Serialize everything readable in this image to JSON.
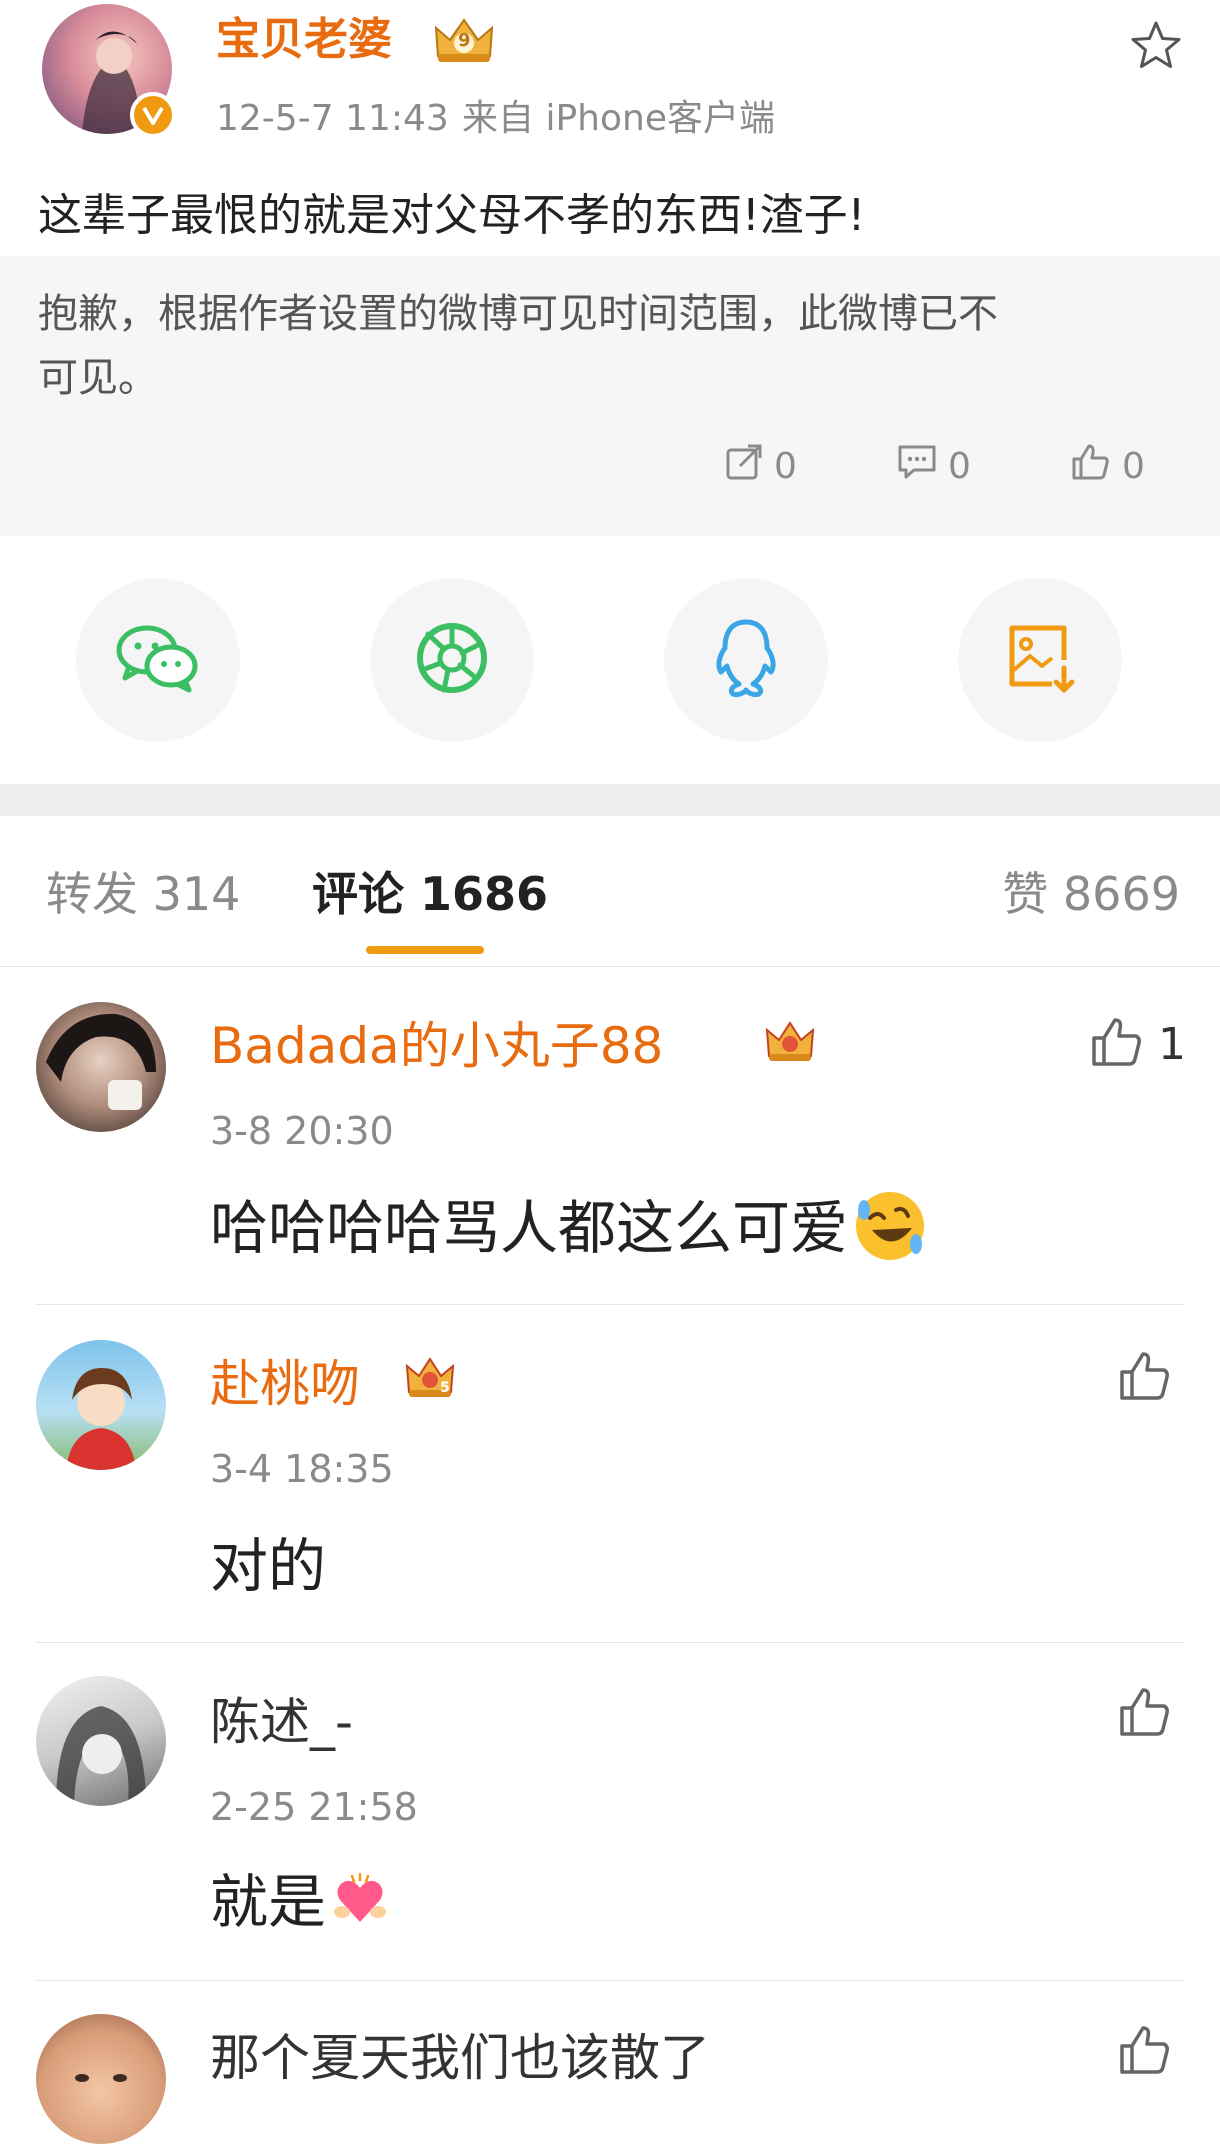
{
  "post": {
    "username": "宝贝老婆",
    "vip_level": "9",
    "date": "12-5-7 11:43",
    "source": "来自 iPhone客户端",
    "text": "这辈子最恨的就是对父母不孝的东西!渣子!",
    "quoted": {
      "text_line1": "抱歉，根据作者设置的微博可见时间范围，此微博已不",
      "text_line2": "可见。",
      "repost_count": "0",
      "comment_count": "0",
      "like_count": "0"
    }
  },
  "share": {
    "items": [
      {
        "name": "wechat",
        "icon": "wechat-icon",
        "color": "#3cbf63"
      },
      {
        "name": "moments",
        "icon": "moments-icon",
        "color": "#3cbf63"
      },
      {
        "name": "qq",
        "icon": "qq-icon",
        "color": "#3aa6e6"
      },
      {
        "name": "save-image",
        "icon": "save-image-icon",
        "color": "#f09a11"
      }
    ]
  },
  "tabs": {
    "repost": "转发 314",
    "comments": "评论 1686",
    "likes": "赞 8669"
  },
  "comments": [
    {
      "user": "Badada的小丸子88",
      "time": "3-8 20:30",
      "text": "哈哈哈哈骂人都这么可爱",
      "likes": "1",
      "vip": true
    },
    {
      "user": "赴桃吻",
      "time": "3-4 18:35",
      "text": "对的",
      "likes": "",
      "vip": true,
      "vip_level": "5"
    },
    {
      "user": "陈述_-",
      "time": "2-25 21:58",
      "text": "就是",
      "likes": "",
      "vip": false
    },
    {
      "user": "那个夏天我们也该散了",
      "time": "",
      "text": "",
      "likes": "",
      "vip": false
    }
  ],
  "colors": {
    "accent_orange": "#e86b0f",
    "tab_indicator": "#f09a11",
    "background": "#ffffff",
    "quoted_background": "#f6f6f6",
    "gap_background": "#efefef"
  }
}
